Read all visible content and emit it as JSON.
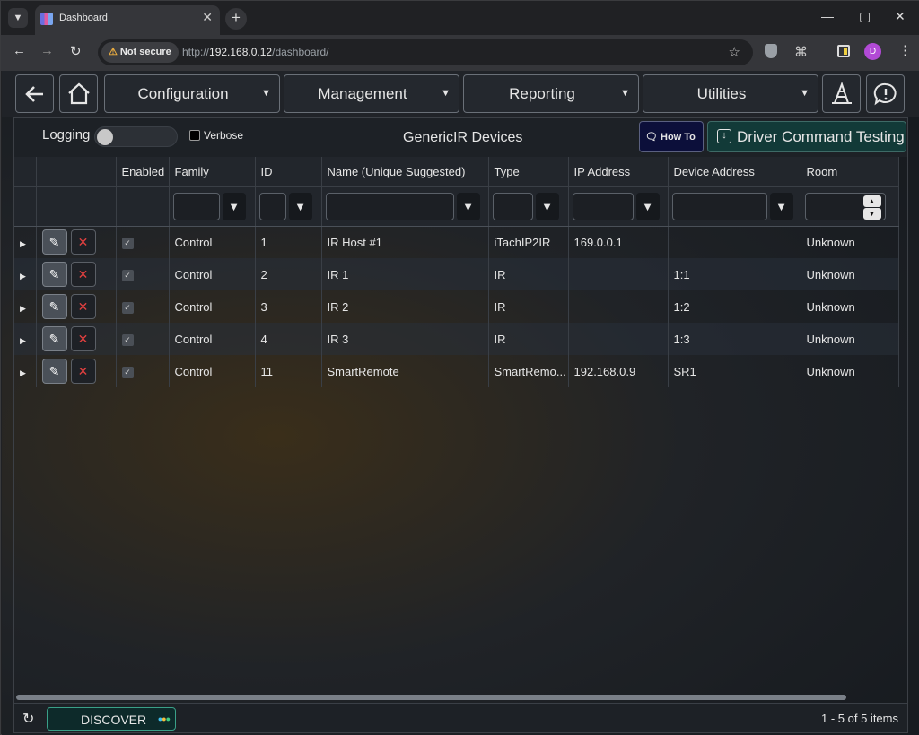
{
  "browser": {
    "tab_title": "Dashboard",
    "security_label": "Not secure",
    "url_prefix": "http://",
    "url_host": "192.168.0.12",
    "url_path": "/dashboard/",
    "profile_initial": "D"
  },
  "topbar": {
    "menus": [
      "Configuration",
      "Management",
      "Reporting",
      "Utilities"
    ]
  },
  "toolbar": {
    "logging_label": "Logging",
    "verbose_label": "Verbose",
    "title": "GenericIR Devices",
    "howto_label": "How To",
    "driver_test_label": "Driver Command Testing"
  },
  "table": {
    "columns": [
      "Enabled",
      "Family",
      "ID",
      "Name (Unique Suggested)",
      "Type",
      "IP Address",
      "Device Address",
      "Room"
    ],
    "rows": [
      {
        "family": "Control",
        "id": "1",
        "name": "IR Host #1",
        "type": "iTachIP2IR",
        "ip": "169.0.0.1",
        "address": "",
        "room": "Unknown"
      },
      {
        "family": "Control",
        "id": "2",
        "name": "IR 1",
        "type": "IR",
        "ip": "",
        "address": "1:1",
        "room": "Unknown"
      },
      {
        "family": "Control",
        "id": "3",
        "name": "IR 2",
        "type": "IR",
        "ip": "",
        "address": "1:2",
        "room": "Unknown"
      },
      {
        "family": "Control",
        "id": "4",
        "name": "IR 3",
        "type": "IR",
        "ip": "",
        "address": "1:3",
        "room": "Unknown"
      },
      {
        "family": "Control",
        "id": "11",
        "name": "SmartRemote",
        "type": "SmartRemo...",
        "ip": "192.168.0.9",
        "address": "SR1",
        "room": "Unknown"
      }
    ]
  },
  "pager": {
    "discover_label": "DISCOVER",
    "info": "1 - 5 of 5 items"
  }
}
